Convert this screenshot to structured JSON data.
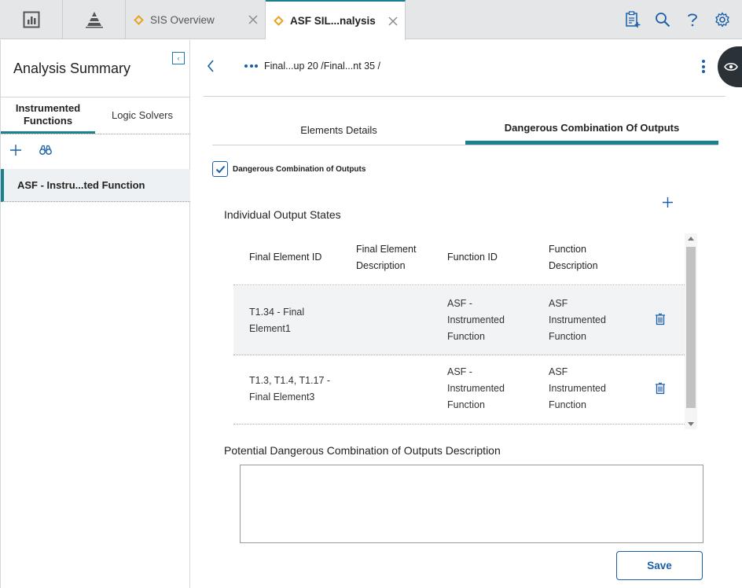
{
  "top_tabs": [
    {
      "label": "SIS Overview",
      "icon": "diamond-icon",
      "active": false
    },
    {
      "label": "ASF SIL...nalysis",
      "icon": "diamond-icon",
      "active": true
    }
  ],
  "top_icons": [
    "dashboard-icon",
    "pyramid-icon"
  ],
  "tools": [
    "clipboard-add-icon",
    "search-icon",
    "help-icon",
    "gear-icon"
  ],
  "left_panel": {
    "title": "Analysis Summary",
    "tabs": [
      "Instrumented Functions",
      "Logic Solvers"
    ],
    "active_tab": 0,
    "items": [
      "ASF - Instru...ted Function"
    ]
  },
  "breadcrumb": "Final...up 20 /Final...nt 35 /",
  "main_tabs": [
    "Elements Details",
    "Dangerous Combination Of Outputs"
  ],
  "active_main_tab": 1,
  "checkbox": {
    "label": "Dangerous Combination of Outputs",
    "checked": true
  },
  "individual_output_states": {
    "title": "Individual Output States",
    "columns": [
      [
        "Final Element ID"
      ],
      [
        "Final Element",
        "Description"
      ],
      [
        "Function ID"
      ],
      [
        "Function",
        "Description"
      ]
    ],
    "rows": [
      {
        "final_element_id": [
          "T1.34 - Final",
          "Element1"
        ],
        "final_element_description": [],
        "function_id": [
          "ASF -",
          "Instrumented",
          "Function"
        ],
        "function_description": [
          "ASF",
          "Instrumented",
          "Function"
        ]
      },
      {
        "final_element_id": [
          "T1.3, T1.4, T1.17 -",
          "Final Element3"
        ],
        "final_element_description": [],
        "function_id": [
          "ASF -",
          "Instrumented",
          "Function"
        ],
        "function_description": [
          "ASF",
          "Instrumented",
          "Function"
        ]
      }
    ]
  },
  "description_section": {
    "title": "Potential Dangerous Combination of Outputs Description",
    "value": ""
  },
  "save_label": "Save",
  "colors": {
    "accent": "#1a7f8e",
    "link": "#1b5fa8",
    "tab_icon": "#e8a31c"
  }
}
